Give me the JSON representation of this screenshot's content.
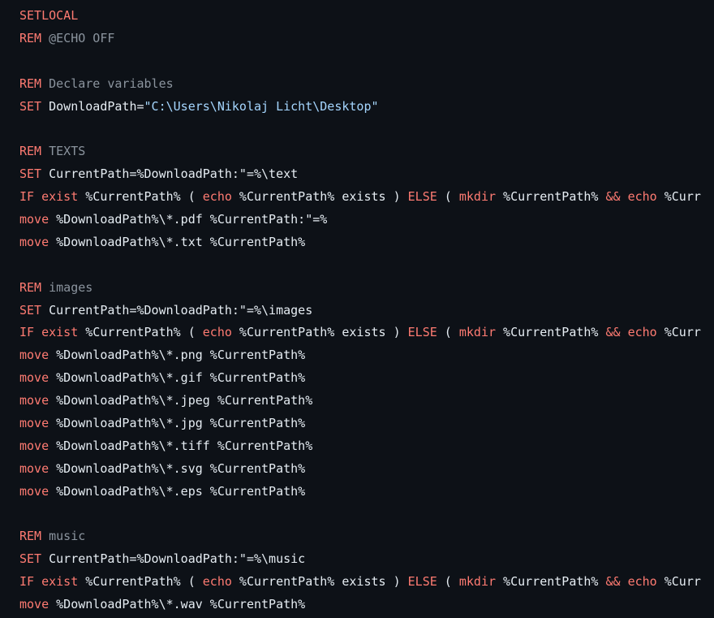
{
  "colors": {
    "background": "#0d1117",
    "keyword": "#ff7b72",
    "comment": "#8b949e",
    "string": "#a5d6ff",
    "text": "#e6edf3"
  },
  "lines": [
    [
      {
        "t": "keyword",
        "v": "SETLOCAL"
      }
    ],
    [
      {
        "t": "keyword",
        "v": "REM"
      },
      {
        "t": "comment",
        "v": " @ECHO OFF"
      }
    ],
    [],
    [
      {
        "t": "keyword",
        "v": "REM"
      },
      {
        "t": "comment",
        "v": " Declare variables"
      }
    ],
    [
      {
        "t": "keyword",
        "v": "SET"
      },
      {
        "t": "text",
        "v": " DownloadPath="
      },
      {
        "t": "string",
        "v": "\"C:\\Users\\Nikolaj Licht\\Desktop\""
      }
    ],
    [],
    [
      {
        "t": "keyword",
        "v": "REM"
      },
      {
        "t": "comment",
        "v": " TEXTS"
      }
    ],
    [
      {
        "t": "keyword",
        "v": "SET"
      },
      {
        "t": "text",
        "v": " CurrentPath=%DownloadPath:\"=%\\text"
      }
    ],
    [
      {
        "t": "keyword",
        "v": "IF"
      },
      {
        "t": "text",
        "v": " "
      },
      {
        "t": "keyword",
        "v": "exist"
      },
      {
        "t": "text",
        "v": " %CurrentPath% ( "
      },
      {
        "t": "keyword",
        "v": "echo"
      },
      {
        "t": "text",
        "v": " %CurrentPath% exists ) "
      },
      {
        "t": "keyword",
        "v": "ELSE"
      },
      {
        "t": "text",
        "v": " ( "
      },
      {
        "t": "keyword",
        "v": "mkdir"
      },
      {
        "t": "text",
        "v": " %CurrentPath% "
      },
      {
        "t": "keyword",
        "v": "&&"
      },
      {
        "t": "text",
        "v": " "
      },
      {
        "t": "keyword",
        "v": "echo"
      },
      {
        "t": "text",
        "v": " %Curr"
      }
    ],
    [
      {
        "t": "keyword",
        "v": "move"
      },
      {
        "t": "text",
        "v": " %DownloadPath%\\*.pdf %CurrentPath:\"=%"
      }
    ],
    [
      {
        "t": "keyword",
        "v": "move"
      },
      {
        "t": "text",
        "v": " %DownloadPath%\\*.txt %CurrentPath%"
      }
    ],
    [],
    [
      {
        "t": "keyword",
        "v": "REM"
      },
      {
        "t": "comment",
        "v": " images"
      }
    ],
    [
      {
        "t": "keyword",
        "v": "SET"
      },
      {
        "t": "text",
        "v": " CurrentPath=%DownloadPath:\"=%\\images"
      }
    ],
    [
      {
        "t": "keyword",
        "v": "IF"
      },
      {
        "t": "text",
        "v": " "
      },
      {
        "t": "keyword",
        "v": "exist"
      },
      {
        "t": "text",
        "v": " %CurrentPath% ( "
      },
      {
        "t": "keyword",
        "v": "echo"
      },
      {
        "t": "text",
        "v": " %CurrentPath% exists ) "
      },
      {
        "t": "keyword",
        "v": "ELSE"
      },
      {
        "t": "text",
        "v": " ( "
      },
      {
        "t": "keyword",
        "v": "mkdir"
      },
      {
        "t": "text",
        "v": " %CurrentPath% "
      },
      {
        "t": "keyword",
        "v": "&&"
      },
      {
        "t": "text",
        "v": " "
      },
      {
        "t": "keyword",
        "v": "echo"
      },
      {
        "t": "text",
        "v": " %Curr"
      }
    ],
    [
      {
        "t": "keyword",
        "v": "move"
      },
      {
        "t": "text",
        "v": " %DownloadPath%\\*.png %CurrentPath%"
      }
    ],
    [
      {
        "t": "keyword",
        "v": "move"
      },
      {
        "t": "text",
        "v": " %DownloadPath%\\*.gif %CurrentPath%"
      }
    ],
    [
      {
        "t": "keyword",
        "v": "move"
      },
      {
        "t": "text",
        "v": " %DownloadPath%\\*.jpeg %CurrentPath%"
      }
    ],
    [
      {
        "t": "keyword",
        "v": "move"
      },
      {
        "t": "text",
        "v": " %DownloadPath%\\*.jpg %CurrentPath%"
      }
    ],
    [
      {
        "t": "keyword",
        "v": "move"
      },
      {
        "t": "text",
        "v": " %DownloadPath%\\*.tiff %CurrentPath%"
      }
    ],
    [
      {
        "t": "keyword",
        "v": "move"
      },
      {
        "t": "text",
        "v": " %DownloadPath%\\*.svg %CurrentPath%"
      }
    ],
    [
      {
        "t": "keyword",
        "v": "move"
      },
      {
        "t": "text",
        "v": " %DownloadPath%\\*.eps %CurrentPath%"
      }
    ],
    [],
    [
      {
        "t": "keyword",
        "v": "REM"
      },
      {
        "t": "comment",
        "v": " music"
      }
    ],
    [
      {
        "t": "keyword",
        "v": "SET"
      },
      {
        "t": "text",
        "v": " CurrentPath=%DownloadPath:\"=%\\music"
      }
    ],
    [
      {
        "t": "keyword",
        "v": "IF"
      },
      {
        "t": "text",
        "v": " "
      },
      {
        "t": "keyword",
        "v": "exist"
      },
      {
        "t": "text",
        "v": " %CurrentPath% ( "
      },
      {
        "t": "keyword",
        "v": "echo"
      },
      {
        "t": "text",
        "v": " %CurrentPath% exists ) "
      },
      {
        "t": "keyword",
        "v": "ELSE"
      },
      {
        "t": "text",
        "v": " ( "
      },
      {
        "t": "keyword",
        "v": "mkdir"
      },
      {
        "t": "text",
        "v": " %CurrentPath% "
      },
      {
        "t": "keyword",
        "v": "&&"
      },
      {
        "t": "text",
        "v": " "
      },
      {
        "t": "keyword",
        "v": "echo"
      },
      {
        "t": "text",
        "v": " %Curr"
      }
    ],
    [
      {
        "t": "keyword",
        "v": "move"
      },
      {
        "t": "text",
        "v": " %DownloadPath%\\*.wav %CurrentPath%"
      }
    ]
  ]
}
